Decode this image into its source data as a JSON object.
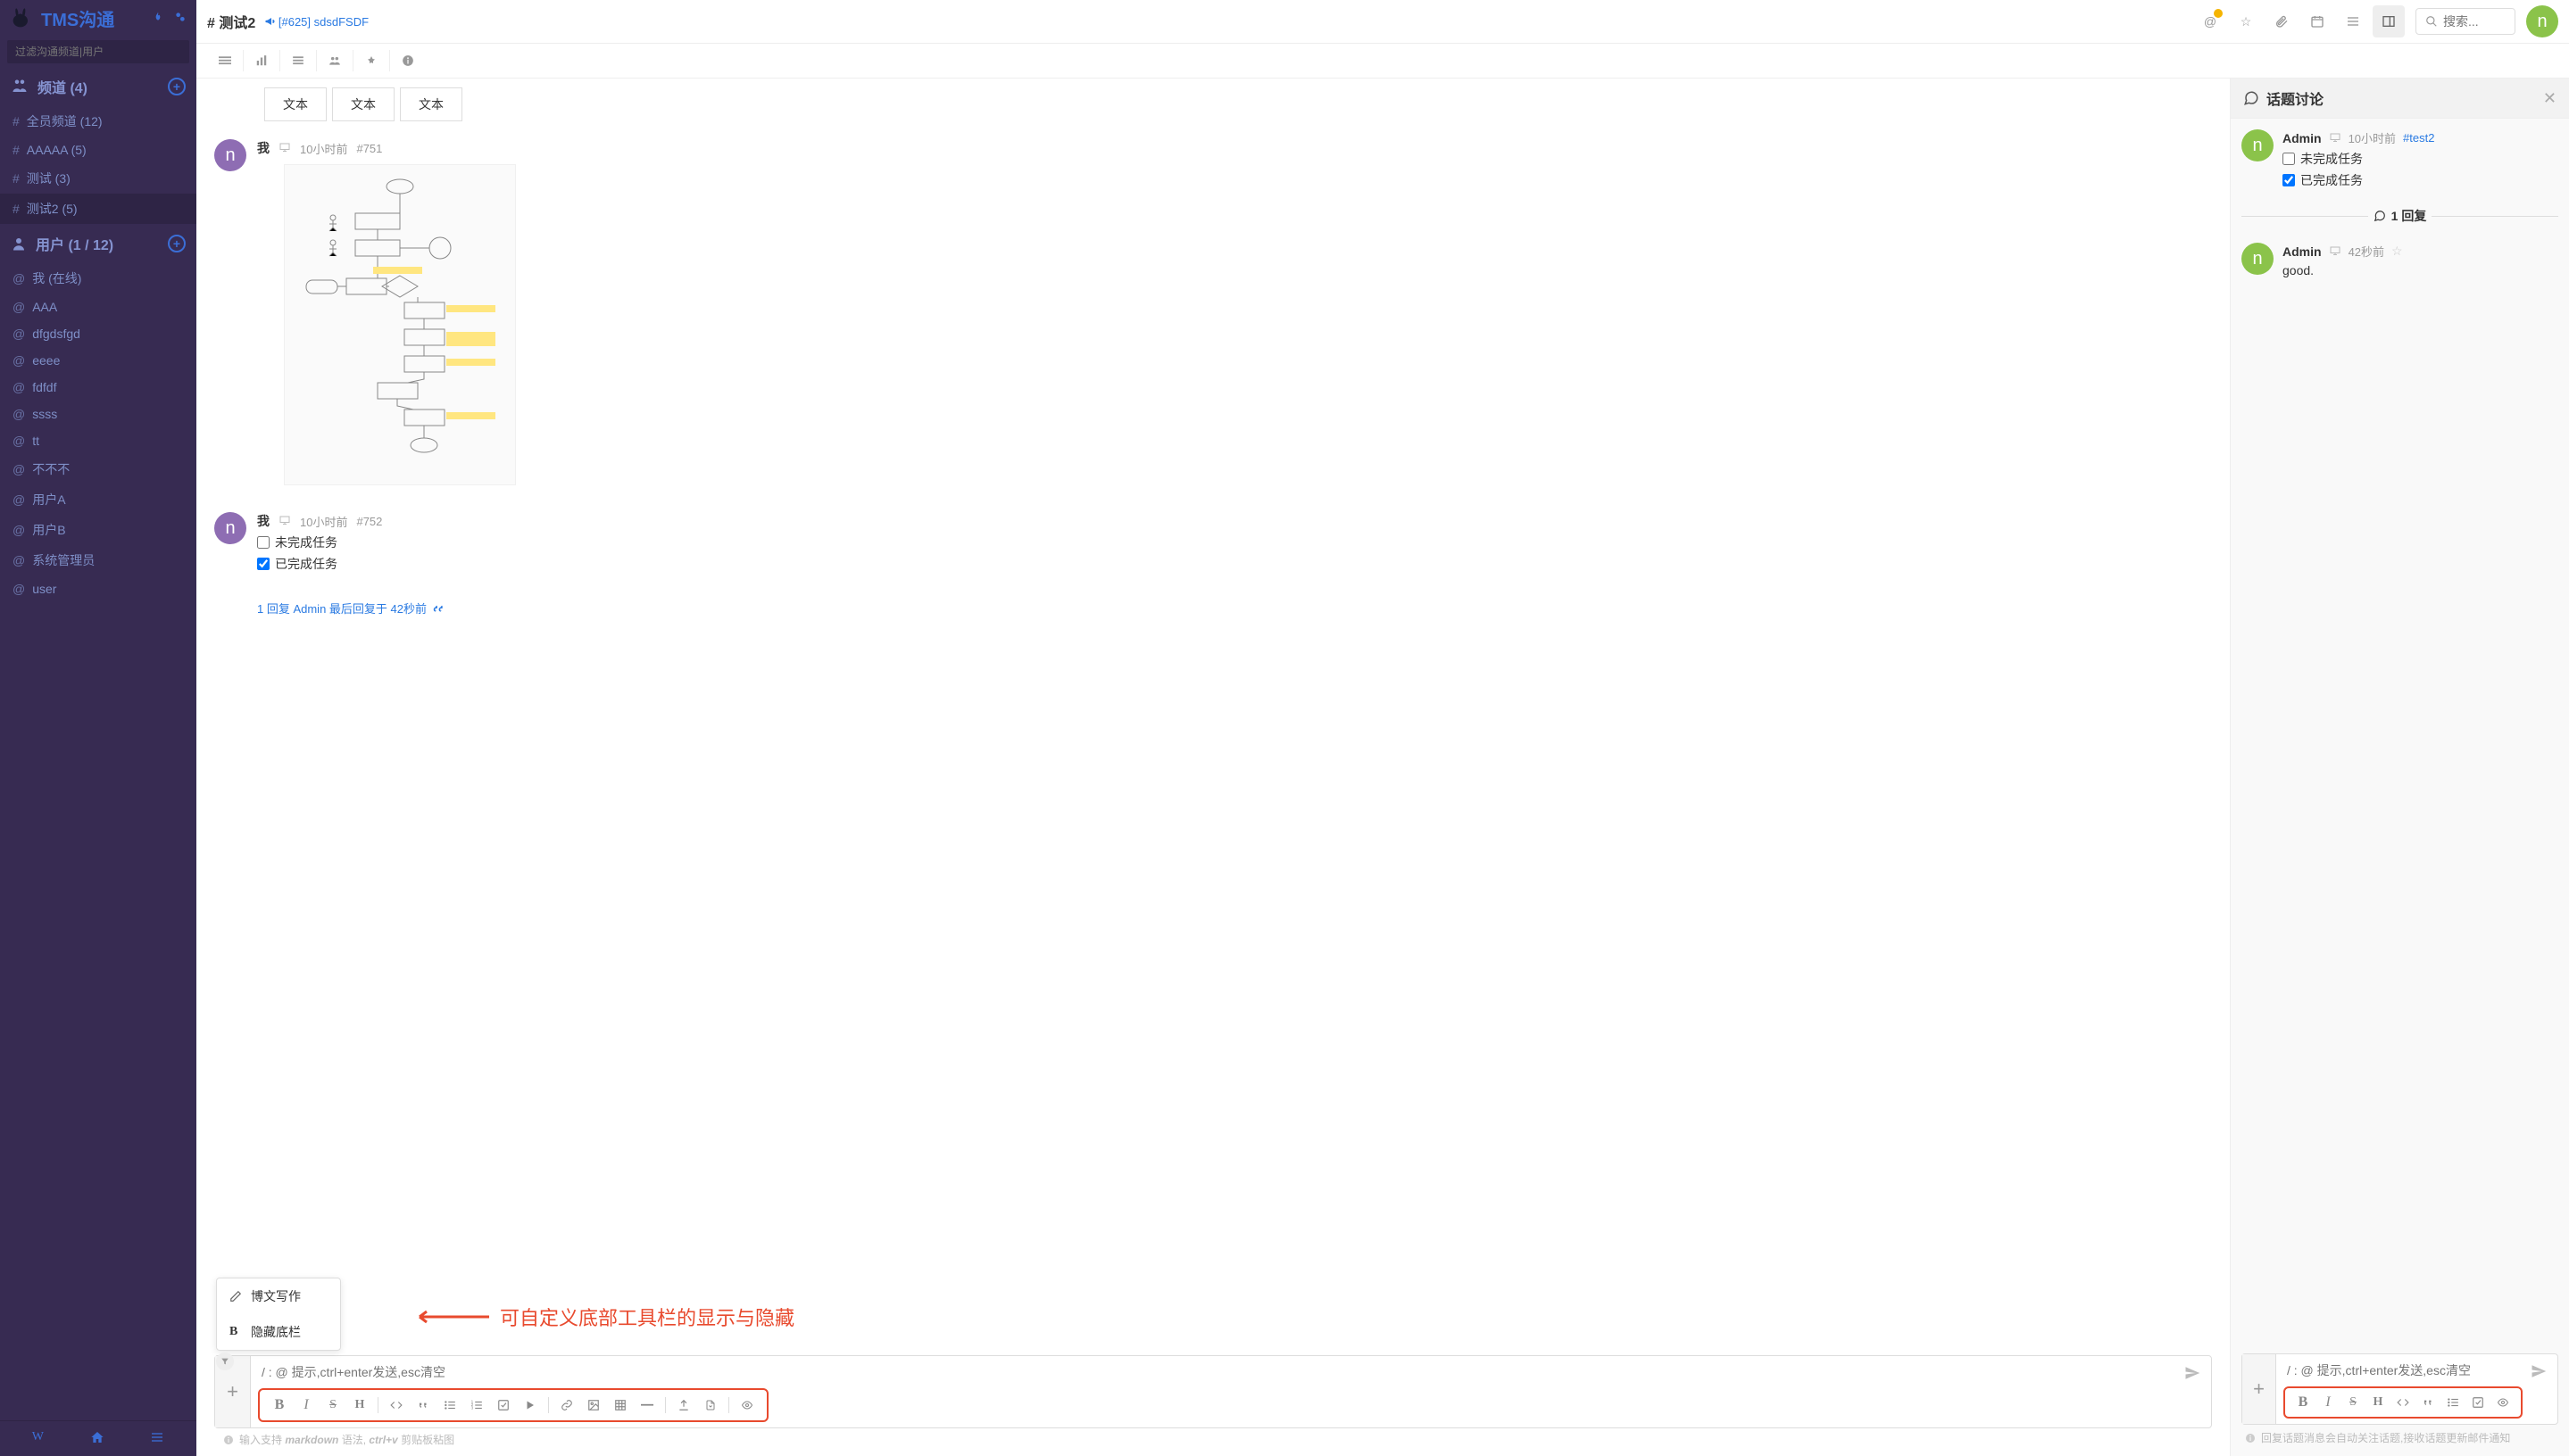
{
  "brand": "TMS沟通",
  "filter_placeholder": "过滤沟通频道|用户",
  "sections": {
    "channels": {
      "title": "频道 (4)",
      "items": [
        {
          "label": "全员频道 (12)"
        },
        {
          "label": "AAAAA (5)"
        },
        {
          "label": "测试 (3)"
        },
        {
          "label": "测试2 (5)"
        }
      ]
    },
    "users": {
      "title": "用户 (1 / 12)",
      "items": [
        {
          "label": "我 (在线)"
        },
        {
          "label": "AAA"
        },
        {
          "label": "dfgdsfgd"
        },
        {
          "label": "eeee"
        },
        {
          "label": "fdfdf"
        },
        {
          "label": "ssss"
        },
        {
          "label": "tt"
        },
        {
          "label": "不不不"
        },
        {
          "label": "用户A"
        },
        {
          "label": "用户B"
        },
        {
          "label": "系统管理员"
        },
        {
          "label": "user"
        }
      ]
    }
  },
  "channel": {
    "title": "# 测试2",
    "link": "[#625] sdsdFSDF"
  },
  "search_placeholder": "搜索...",
  "avatar_letter": "n",
  "text_cells": [
    "文本",
    "文本",
    "文本"
  ],
  "messages": [
    {
      "author": "我",
      "time": "10小时前",
      "id": "#751"
    },
    {
      "author": "我",
      "time": "10小时前",
      "id": "#752",
      "tasks": [
        {
          "done": false,
          "label": "未完成任务"
        },
        {
          "done": true,
          "label": "已完成任务"
        }
      ],
      "reply": "1 回复 Admin 最后回复于 42秒前"
    }
  ],
  "popup": {
    "item1": "博文写作",
    "item2": "隐藏底栏"
  },
  "annotation": "可自定义底部工具栏的显示与隐藏",
  "composer": {
    "placeholder": "/ : @ 提示,ctrl+enter发送,esc清空",
    "hint_prefix": "输入支持 ",
    "hint_md": "markdown",
    "hint_mid": " 语法, ",
    "hint_ctrl": "ctrl+v",
    "hint_suffix": " 剪贴板粘图"
  },
  "panel": {
    "title": "话题讨论",
    "original": {
      "author": "Admin",
      "time": "10小时前",
      "link": "#test2",
      "tasks": [
        {
          "done": false,
          "label": "未完成任务"
        },
        {
          "done": true,
          "label": "已完成任务"
        }
      ]
    },
    "reply_count": "1 回复",
    "reply": {
      "author": "Admin",
      "time": "42秒前",
      "body": "good."
    },
    "hint": "回复话题消息会自动关注话题,接收话题更新邮件通知"
  }
}
